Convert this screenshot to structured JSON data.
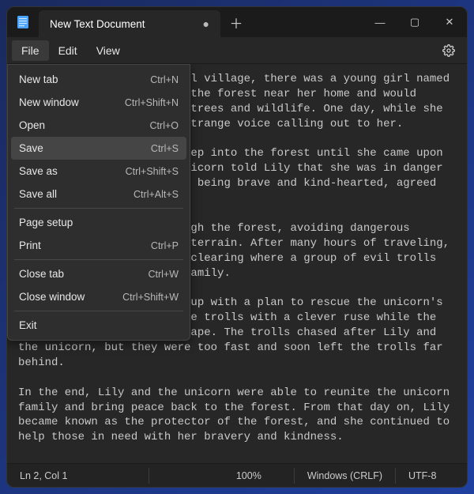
{
  "titlebar": {
    "tab_title": "New Text Document",
    "modified_indicator": "●",
    "new_tab": "＋",
    "minimize": "—",
    "maximize": "▢",
    "close": "✕"
  },
  "menubar": {
    "file": "File",
    "edit": "Edit",
    "view": "View"
  },
  "file_menu": {
    "items": [
      {
        "label": "New tab",
        "shortcut": "Ctrl+N"
      },
      {
        "label": "New window",
        "shortcut": "Ctrl+Shift+N"
      },
      {
        "label": "Open",
        "shortcut": "Ctrl+O"
      },
      {
        "label": "Save",
        "shortcut": "Ctrl+S"
      },
      {
        "label": "Save as",
        "shortcut": "Ctrl+Shift+S"
      },
      {
        "label": "Save all",
        "shortcut": "Ctrl+Alt+S"
      },
      {
        "label": "Page setup",
        "shortcut": ""
      },
      {
        "label": "Print",
        "shortcut": "Ctrl+P"
      },
      {
        "label": "Close tab",
        "shortcut": "Ctrl+W"
      },
      {
        "label": "Close window",
        "shortcut": "Ctrl+Shift+W"
      },
      {
        "label": "Exit",
        "shortcut": ""
      }
    ],
    "hover_index": 3,
    "separators_after": [
      5,
      7,
      9
    ]
  },
  "editor": {
    "text": "Once upon a time in a small village, there was a young girl named Lily who loved to play in the forest near her home and would spend hours exploring the trees and wildlife. One day, while she was playing, she heard a strange voice calling out to her.\n\nLily followed the voice deep into the forest until she came upon a mythical unicorn. The unicorn told Lily that she was in danger and needed her help. Lily, being brave and kind-hearted, agreed to help the unicorn.\n\nThe unicorn led Lily through the forest, avoiding dangerous creatures and treacherous terrain. After many hours of traveling, they finally arrived at a clearing where a group of evil trolls had captured the unicorn family.\n\nLily and the unicorn came up with a plan to rescue the unicorn's family. Lily distracted the trolls with a clever ruse while the unicorn's family could escape. The trolls chased after Lily and the unicorn, but they were too fast and soon left the trolls far behind.\n\nIn the end, Lily and the unicorn were able to reunite the unicorn family and bring peace back to the forest. From that day on, Lily became known as the protector of the forest, and she continued to help those in need with her bravery and kindness."
  },
  "statusbar": {
    "position": "Ln 2, Col 1",
    "zoom": "100%",
    "line_ending": "Windows (CRLF)",
    "encoding": "UTF-8"
  }
}
